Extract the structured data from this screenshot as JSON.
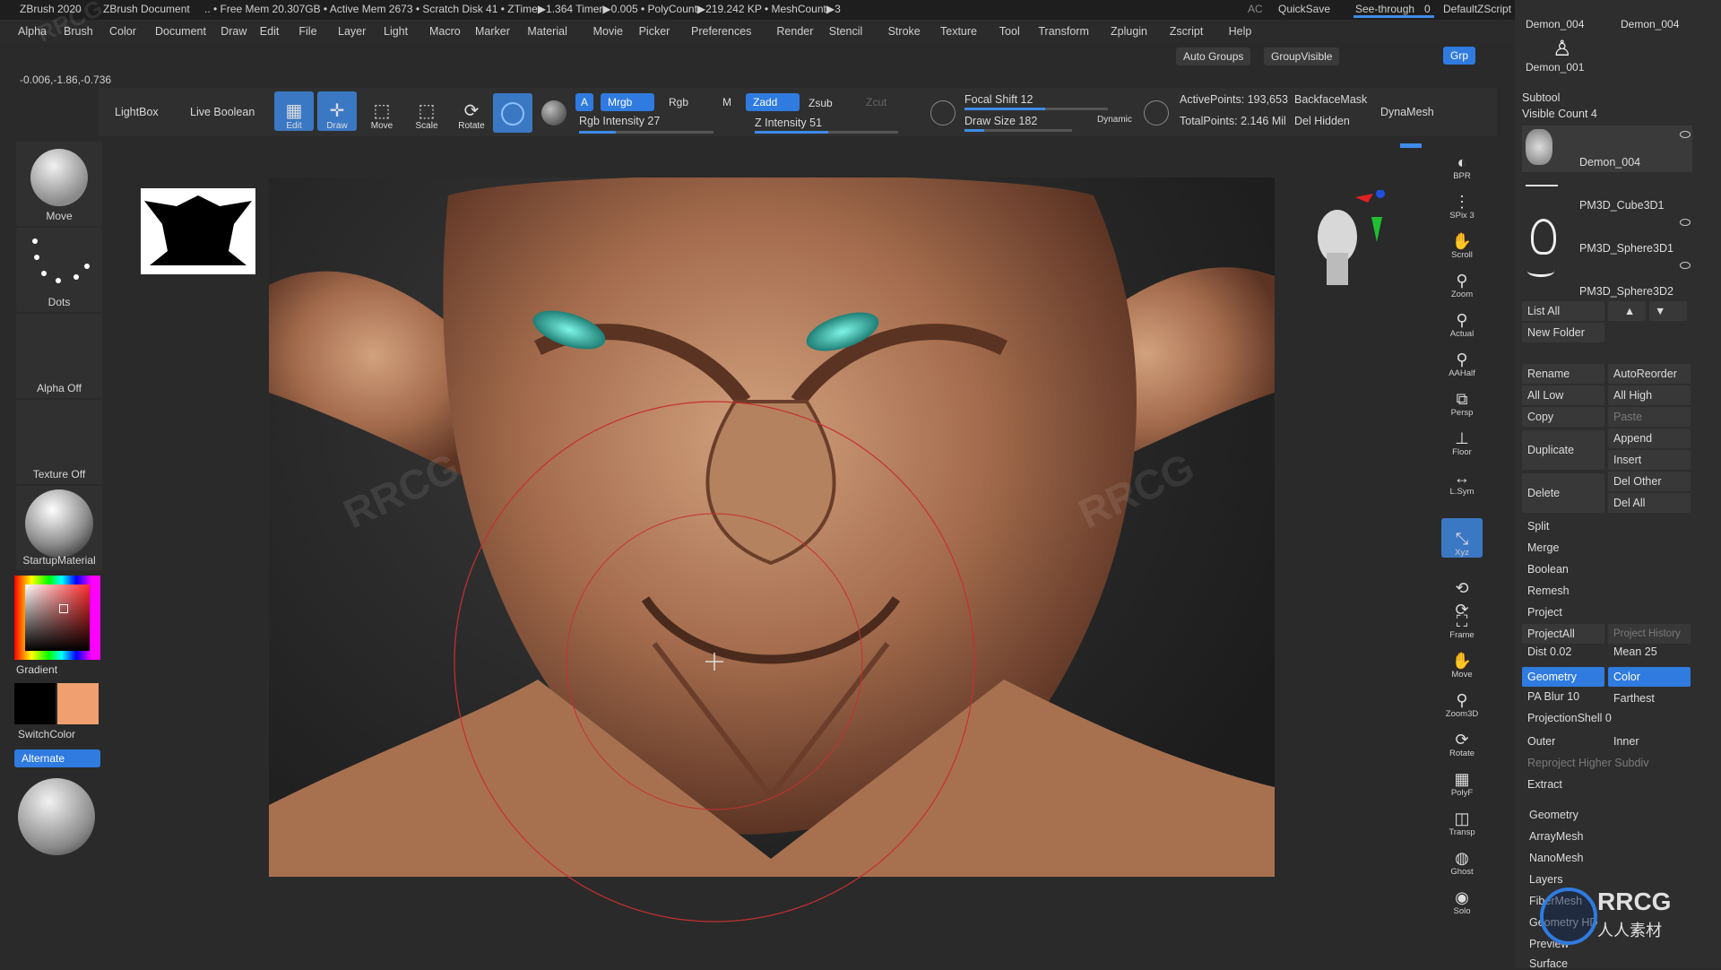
{
  "titlebar": {
    "app": "ZBrush 2020",
    "doc": "ZBrush Document",
    "stats": ".. • Free Mem 20.307GB • Active Mem 2673 • Scratch Disk 41 • ZTime▶1.364 Timer▶0.005 • PolyCount▶219.242 KP • MeshCount▶3",
    "ac": "AC",
    "quicksave": "QuickSave",
    "seethrough": "See-through",
    "seethrough_value": "0",
    "script": "DefaultZScript"
  },
  "menu": [
    "Alpha",
    "Brush",
    "Color",
    "Document",
    "Draw",
    "Edit",
    "File",
    "Layer",
    "Light",
    "Macro",
    "Marker",
    "Material",
    "Movie",
    "Picker",
    "Preferences",
    "Render",
    "Stencil",
    "Stroke",
    "Texture",
    "Tool",
    "Transform",
    "Zplugin",
    "Zscript",
    "Help"
  ],
  "menu_extra": {
    "auto_groups": "Auto Groups",
    "group_visible": "GroupVisible",
    "grp": "Grp"
  },
  "coordinates": "-0.006,-1.86,-0.736",
  "toolbar": {
    "lightbox": "LightBox",
    "live_boolean": "Live Boolean",
    "edit": "Edit",
    "draw": "Draw",
    "move": "Move",
    "scale": "Scale",
    "rotate": "Rotate",
    "a": "A",
    "mrgb": "Mrgb",
    "rgb": "Rgb",
    "m": "M",
    "zadd": "Zadd",
    "zsub": "Zsub",
    "zcut": "Zcut",
    "rgb_intensity": "Rgb Intensity 27",
    "rgb_intensity_value": 27,
    "z_intensity": "Z Intensity 51",
    "z_intensity_value": 51,
    "focal_shift": "Focal Shift 12",
    "focal_shift_value": 12,
    "draw_size": "Draw Size 182",
    "draw_size_value": 182,
    "dynamic": "Dynamic",
    "active_points": "ActivePoints: 193,653",
    "total_points": "TotalPoints: 2.146 Mil",
    "backface_mask": "BackfaceMask",
    "del_hidden": "Del Hidden",
    "dynamesh": "DynaMesh"
  },
  "shelf": {
    "move": "Move",
    "dots": "Dots",
    "alpha_off": "Alpha Off",
    "texture_off": "Texture Off",
    "material": "StartupMaterial",
    "gradient": "Gradient",
    "switchcolor": "SwitchColor",
    "alternate": "Alternate"
  },
  "colors": {
    "main_color": "#000000",
    "secondary_color": "#f0a070",
    "accent": "#2f7be0",
    "skin": "#b07a5a"
  },
  "rail": [
    "BPR",
    "SPix 3",
    "Scroll",
    "Zoom",
    "Actual",
    "AAHalf",
    "Persp",
    "Floor",
    "L.Sym",
    "",
    "Xyz",
    "",
    "",
    "Frame",
    "Move",
    "Zoom3D",
    "Rotate",
    "PolyF",
    "Transp",
    "Ghost",
    "Solo"
  ],
  "subtool": {
    "header_items": [
      "Demon_004",
      "Demon_004",
      "Demon_001"
    ],
    "title": "Subtool",
    "visible_count": "Visible Count 4",
    "items": [
      "Demon_004",
      "PM3D_Cube3D1",
      "PM3D_Sphere3D1",
      "PM3D_Sphere3D2"
    ],
    "list_all": "List All",
    "new_folder": "New Folder",
    "rename": "Rename",
    "autoreorder": "AutoReorder",
    "all_low": "All Low",
    "all_high": "All High",
    "copy": "Copy",
    "paste": "Paste",
    "duplicate": "Duplicate",
    "append": "Append",
    "insert": "Insert",
    "delete": "Delete",
    "del_other": "Del Other",
    "del_all": "Del All",
    "split": "Split",
    "merge": "Merge",
    "boolean": "Boolean",
    "remesh": "Remesh",
    "project": "Project",
    "project_all": "ProjectAll",
    "project_history": "Project History",
    "dist": "Dist 0.02",
    "mean": "Mean 25",
    "geometry": "Geometry",
    "color": "Color",
    "pa_blur": "PA Blur 10",
    "farthest": "Farthest",
    "projection_shell": "ProjectionShell 0",
    "outer": "Outer",
    "inner": "Inner",
    "reproject": "Reproject Higher Subdiv",
    "extract": "Extract",
    "sections": [
      "Geometry",
      "ArrayMesh",
      "NanoMesh",
      "Layers",
      "FiberMesh",
      "Geometry HD",
      "Preview",
      "Surface"
    ]
  },
  "watermark": {
    "brand": "RRCG",
    "cn": "人人素材"
  }
}
